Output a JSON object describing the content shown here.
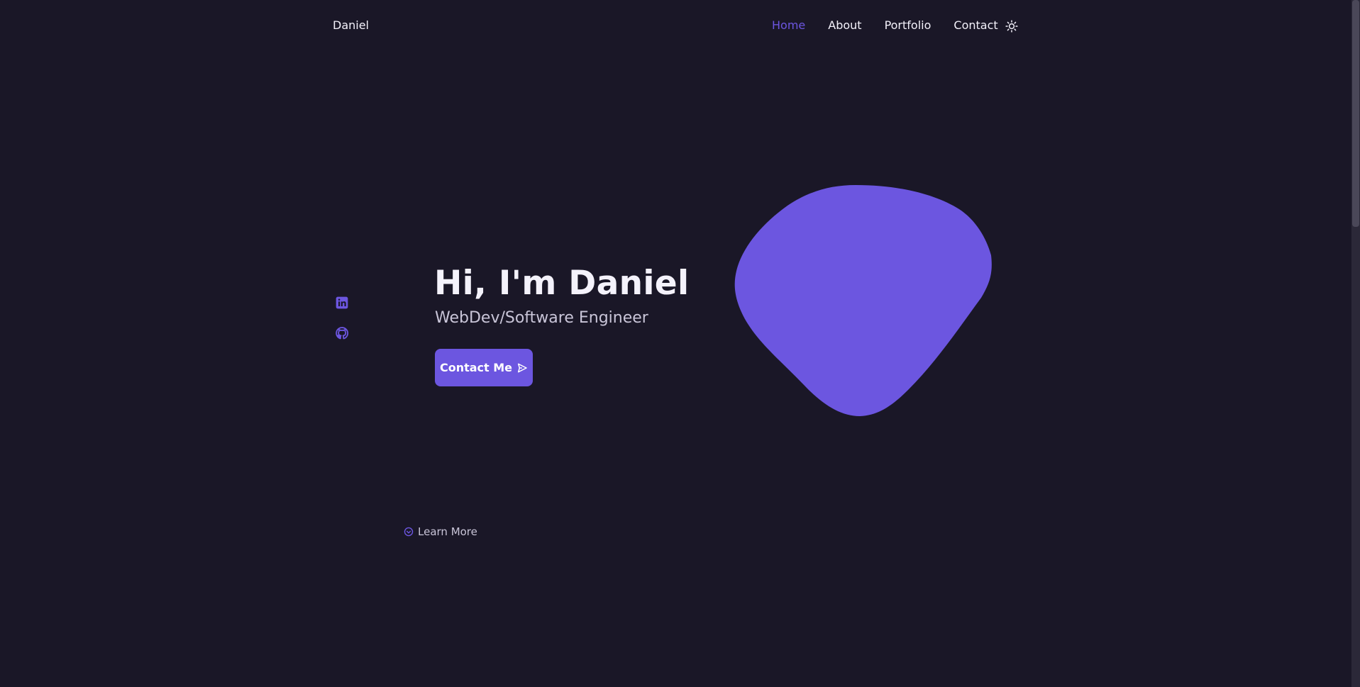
{
  "header": {
    "logo": "Daniel",
    "nav": [
      {
        "label": "Home",
        "active": true
      },
      {
        "label": "About",
        "active": false
      },
      {
        "label": "Portfolio",
        "active": false
      },
      {
        "label": "Contact",
        "active": false
      }
    ],
    "theme_icon": "sun-icon"
  },
  "social": {
    "icons": [
      "linkedin-icon",
      "github-icon"
    ]
  },
  "hero": {
    "title": "Hi, I'm Daniel",
    "subtitle": "WebDev/Software Engineer",
    "cta_label": "Contact Me",
    "cta_icon": "send-icon",
    "blob_color": "#6c56e0"
  },
  "scroll": {
    "learn_more_label": "Learn More",
    "learn_more_icon": "arrow-down-circle-icon"
  },
  "colors": {
    "background": "#1a1727",
    "accent": "#6c56e0",
    "text": "#f4f2fb",
    "muted_text": "#c9c5d8"
  }
}
